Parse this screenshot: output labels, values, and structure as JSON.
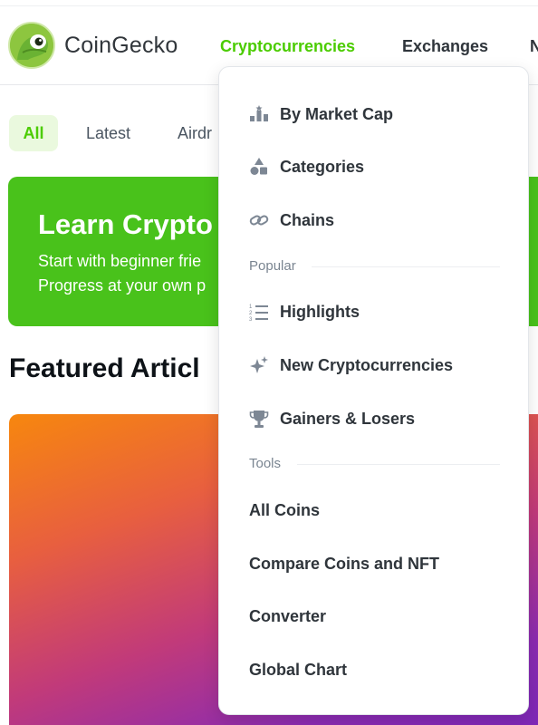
{
  "header": {
    "logo_text": "CoinGecko",
    "nav": {
      "cryptocurrencies": "Cryptocurrencies",
      "exchanges": "Exchanges",
      "more": "N"
    }
  },
  "tabs": {
    "all": "All",
    "latest": "Latest",
    "airdrops": "Airdr"
  },
  "banner": {
    "title": "Learn Crypto",
    "line1": "Start with beginner frie",
    "line2": "Progress at your own p"
  },
  "featured_heading": "Featured Articl",
  "dropdown": {
    "items": [
      {
        "label": "By Market Cap",
        "icon": "bar-chart-icon"
      },
      {
        "label": "Categories",
        "icon": "shapes-icon"
      },
      {
        "label": "Chains",
        "icon": "link-icon"
      }
    ],
    "popular_title": "Popular",
    "popular": [
      {
        "label": "Highlights",
        "icon": "numbered-list-icon"
      },
      {
        "label": "New Cryptocurrencies",
        "icon": "sparkles-icon"
      },
      {
        "label": "Gainers & Losers",
        "icon": "trophy-icon"
      }
    ],
    "tools_title": "Tools",
    "tools": [
      {
        "label": "All Coins"
      },
      {
        "label": "Compare Coins and NFT"
      },
      {
        "label": "Converter"
      },
      {
        "label": "Global Chart"
      }
    ]
  },
  "colors": {
    "brand_green": "#4bcc00",
    "banner_green": "#49c21b",
    "text_dark": "#2f353b",
    "muted": "#7a8591"
  }
}
